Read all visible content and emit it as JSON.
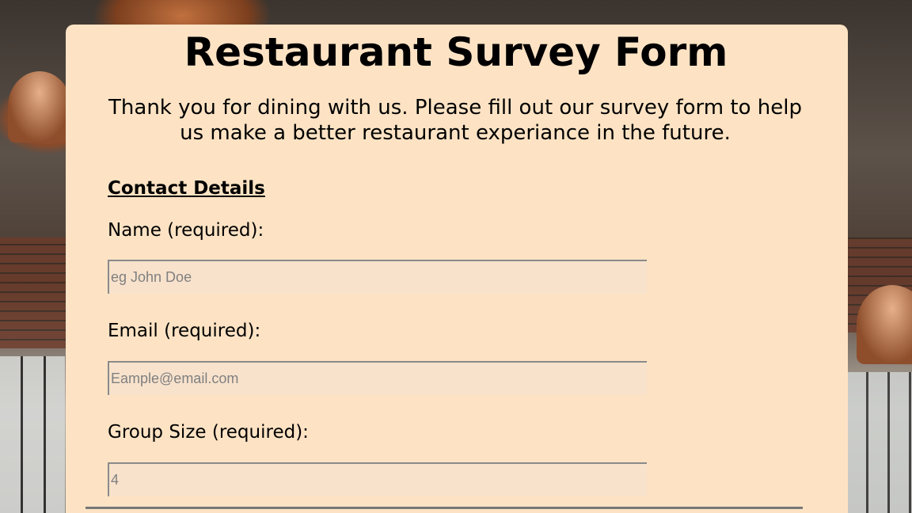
{
  "form": {
    "title": "Restaurant Survey Form",
    "intro": "Thank you for dining with us. Please fill out our survey form to help us make a better restaurant experiance in the future.",
    "section_heading": "Contact Details",
    "fields": {
      "name": {
        "label": "Name (required):",
        "placeholder": "eg John Doe",
        "value": ""
      },
      "email": {
        "label": "Email (required):",
        "placeholder": "Eample@email.com",
        "value": ""
      },
      "group_size": {
        "label": "Group Size (required):",
        "placeholder": "4",
        "value": ""
      }
    }
  },
  "colors": {
    "card_background": "#fde3c4",
    "input_background": "#f8e2cc",
    "input_border": "#8a8a8a",
    "text": "#000000",
    "placeholder_text": "#808080"
  }
}
